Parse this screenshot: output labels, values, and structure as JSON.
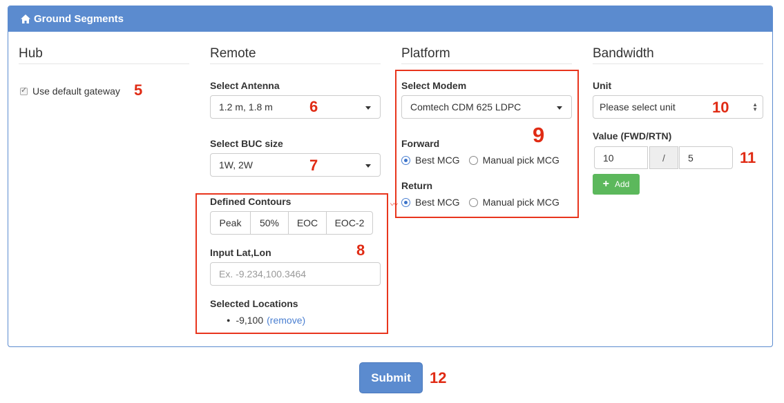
{
  "panel": {
    "title": "Ground Segments",
    "icon": "home-icon"
  },
  "hub": {
    "title": "Hub",
    "use_default_gateway": {
      "label": "Use default gateway",
      "checked": true
    }
  },
  "remote": {
    "title": "Remote",
    "antenna": {
      "label": "Select Antenna",
      "value": "1.2 m, 1.8 m"
    },
    "buc": {
      "label": "Select BUC size",
      "value": "1W, 2W"
    },
    "contours": {
      "label": "Defined Contours",
      "options": [
        "Peak",
        "50%",
        "EOC",
        "EOC-2"
      ]
    },
    "latlon": {
      "label": "Input Lat,Lon",
      "placeholder": "Ex. -9.234,100.3464"
    },
    "locations": {
      "label": "Selected Locations",
      "items": [
        {
          "value": "-9,100",
          "action": "(remove)"
        }
      ]
    }
  },
  "platform": {
    "title": "Platform",
    "modem": {
      "label": "Select Modem",
      "value": "Comtech CDM 625 LDPC"
    },
    "forward": {
      "label": "Forward",
      "options": [
        "Best MCG",
        "Manual pick MCG"
      ],
      "selected": "Best MCG"
    },
    "return": {
      "label": "Return",
      "options": [
        "Best MCG",
        "Manual pick MCG"
      ],
      "selected": "Best MCG"
    }
  },
  "bandwidth": {
    "title": "Bandwidth",
    "unit": {
      "label": "Unit",
      "value": "Please select unit"
    },
    "value": {
      "label": "Value (FWD/RTN)",
      "fwd": "10",
      "separator": "/",
      "rtn": "5"
    },
    "add_label": "Add"
  },
  "submit_label": "Submit",
  "callouts": [
    "5",
    "6",
    "7",
    "8",
    "9",
    "10",
    "11",
    "12"
  ],
  "colors": {
    "primary": "#5b8bcf",
    "success": "#5cb85c",
    "annotation": "#e8341c",
    "link": "#4a7fd1"
  }
}
